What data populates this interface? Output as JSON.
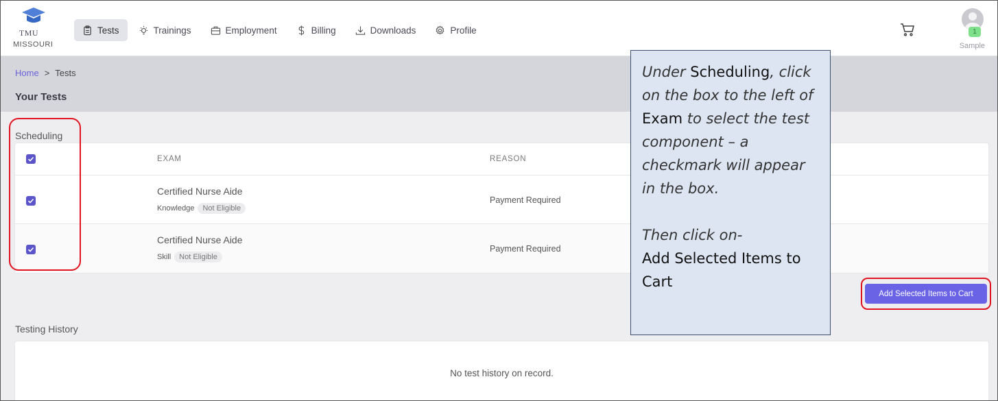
{
  "logo": {
    "line1": "TMU",
    "line2": "MISSOURI"
  },
  "nav": [
    {
      "label": "Tests",
      "icon": "clipboard-icon",
      "active": true
    },
    {
      "label": "Trainings",
      "icon": "lightbulb-icon",
      "active": false
    },
    {
      "label": "Employment",
      "icon": "briefcase-icon",
      "active": false
    },
    {
      "label": "Billing",
      "icon": "dollar-icon",
      "active": false
    },
    {
      "label": "Downloads",
      "icon": "download-icon",
      "active": false
    },
    {
      "label": "Profile",
      "icon": "gear-icon",
      "active": false
    }
  ],
  "header": {
    "cart_count": "1",
    "username": "Sample"
  },
  "breadcrumb": {
    "home": "Home",
    "separator": ">",
    "current": "Tests"
  },
  "page_title": "Your Tests",
  "scheduling": {
    "label": "Scheduling",
    "columns": {
      "exam": "EXAM",
      "reason": "REASON"
    },
    "rows": [
      {
        "exam": "Certified Nurse Aide",
        "type": "Knowledge",
        "status": "Not Eligible",
        "reason": "Payment Required",
        "checked": true
      },
      {
        "exam": "Certified Nurse Aide",
        "type": "Skill",
        "status": "Not Eligible",
        "reason": "Payment Required",
        "checked": true
      }
    ],
    "add_button": "Add Selected Items to Cart"
  },
  "history": {
    "label": "Testing History",
    "empty": "No test history on record."
  },
  "callout": {
    "p1a": "Under ",
    "p1b": "Scheduling",
    "p1c": ", click on the box to the left of ",
    "p1d": "Exam",
    "p1e": " to select the test component – a checkmark will appear in the box.",
    "p2a": "Then click on-",
    "p2b": "Add Selected Items to Cart"
  },
  "colors": {
    "accent": "#6a63e6",
    "annotation_red": "#e0141e",
    "callout_bg": "#dde4f2"
  }
}
